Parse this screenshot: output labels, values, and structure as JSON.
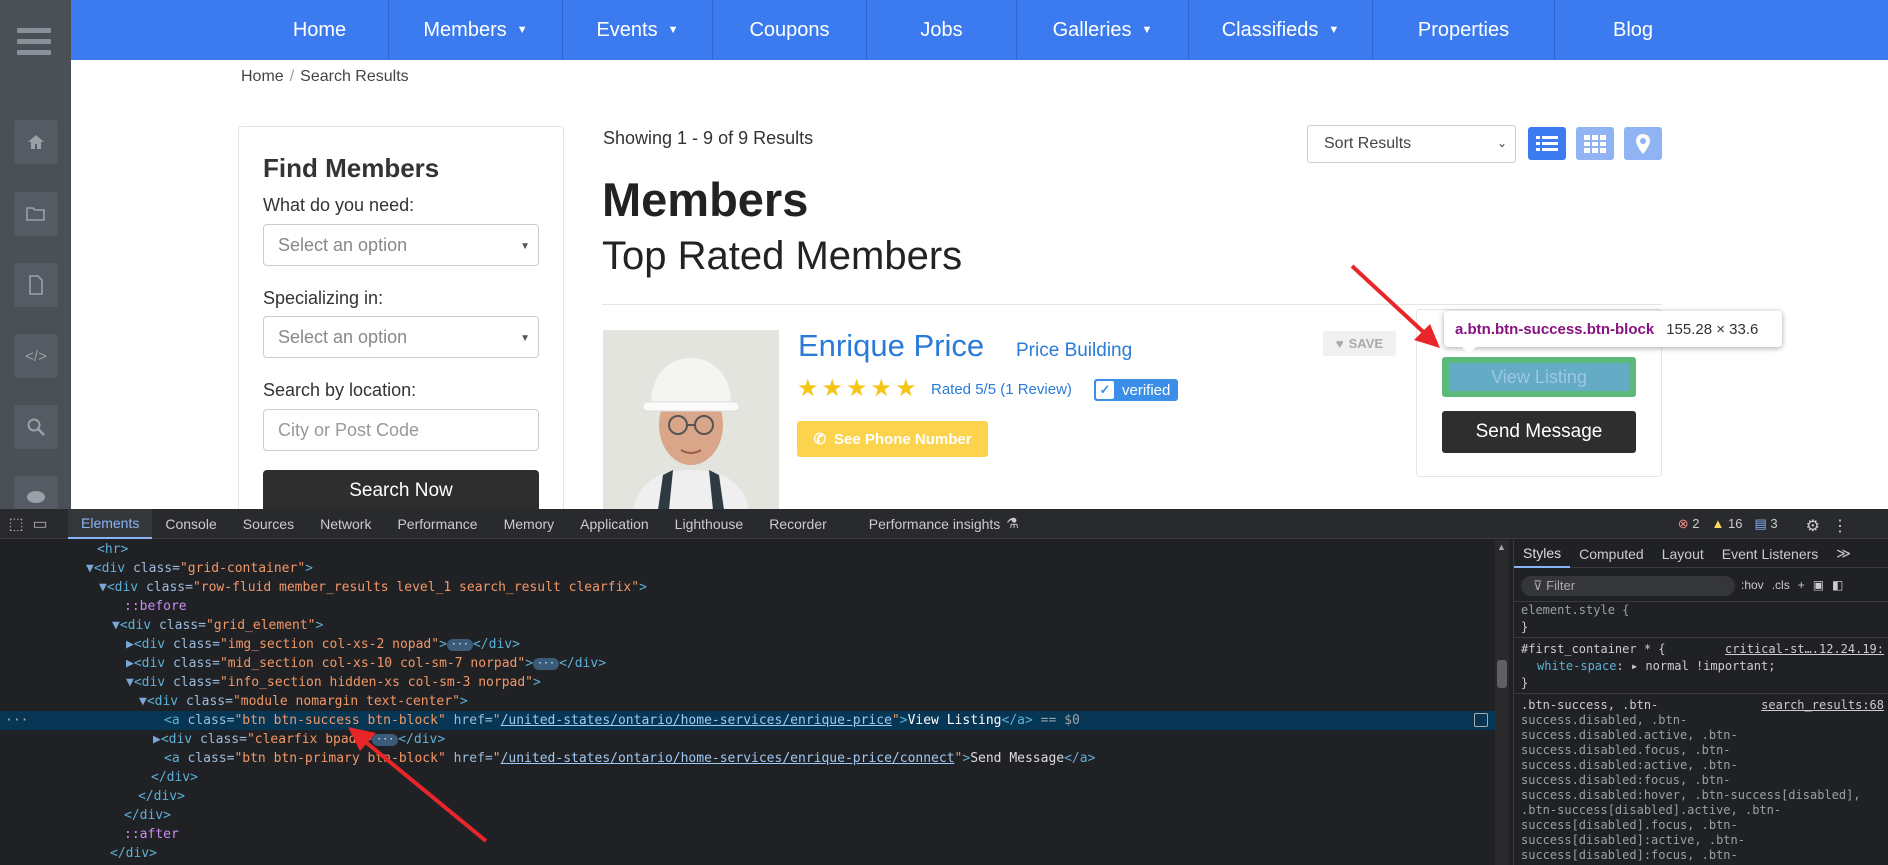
{
  "nav": {
    "items": [
      {
        "label": "Home",
        "dropdown": false
      },
      {
        "label": "Members",
        "dropdown": true
      },
      {
        "label": "Events",
        "dropdown": true
      },
      {
        "label": "Coupons",
        "dropdown": false
      },
      {
        "label": "Jobs",
        "dropdown": false
      },
      {
        "label": "Galleries",
        "dropdown": true
      },
      {
        "label": "Classifieds",
        "dropdown": true
      },
      {
        "label": "Properties",
        "dropdown": false
      },
      {
        "label": "Blog",
        "dropdown": false
      }
    ],
    "color": "#3b7bef"
  },
  "sidebar_icons": [
    "hamburger-icon",
    "home-icon",
    "folder-icon",
    "file-icon",
    "code-icon",
    "zoom-icon",
    "chat-icon"
  ],
  "breadcrumb": {
    "home": "Home",
    "sep": "/",
    "current": "Search Results"
  },
  "find_members": {
    "title": "Find Members",
    "need_label": "What do you need:",
    "need_value": "Select an option",
    "spec_label": "Specializing in:",
    "spec_value": "Select an option",
    "location_label": "Search by location:",
    "location_placeholder": "City or Post Code",
    "search_button": "Search Now"
  },
  "results": {
    "showing": "Showing 1 - 9 of 9 Results",
    "sort_label": "Sort Results",
    "title": "Members",
    "subtitle": "Top Rated Members"
  },
  "member": {
    "name": "Enrique Price",
    "company": "Price Building",
    "stars": "★★★★★",
    "rating_text": "Rated 5/5 (1 Review)",
    "verified": "verified",
    "phone_button": "See Phone Number",
    "save_label": "SAVE",
    "view_listing": "View Listing",
    "send_message": "Send Message"
  },
  "tooltip": {
    "selector": "a.btn.btn-success.btn-block",
    "dims": "155.28 × 33.6"
  },
  "devtools": {
    "tabs": [
      "Elements",
      "Console",
      "Sources",
      "Network",
      "Performance",
      "Memory",
      "Application",
      "Lighthouse",
      "Recorder",
      "Performance insights"
    ],
    "errors": "2",
    "warnings": "16",
    "messages": "3",
    "styles_tabs": [
      "Styles",
      "Computed",
      "Layout",
      "Event Listeners"
    ],
    "filter_placeholder": "Filter",
    "hov": ":hov",
    "cls": ".cls",
    "dom_lines": {
      "l0": "<hr>",
      "l1_tag": "<div ",
      "l1_attr": "class=",
      "l1_val": "\"grid-container\"",
      "l1_end": ">",
      "l2_tag": "<div ",
      "l2_attr": "class=",
      "l2_val": "\"row-fluid member_results level_1 search_result clearfix\"",
      "l2_end": ">",
      "l3": "::before",
      "l4_tag": "<div ",
      "l4_attr": "class=",
      "l4_val": "\"grid_element\"",
      "l4_end": ">",
      "l5_tag": "<div ",
      "l5_attr": "class=",
      "l5_val": "\"img_section col-xs-2 nopad\"",
      "l5_end": "</div>",
      "l6_tag": "<div ",
      "l6_attr": "class=",
      "l6_val": "\"mid_section col-xs-10 col-sm-7 norpad\"",
      "l6_end": "</div>",
      "l7_tag": "<div ",
      "l7_attr": "class=",
      "l7_val": "\"info_section hidden-xs col-sm-3 norpad\"",
      "l7_end": ">",
      "l8_tag": "<div ",
      "l8_attr": "class=",
      "l8_val": "\"module nomargin text-center\"",
      "l8_end": ">",
      "l9_tag": "<a ",
      "l9_attr": "class=",
      "l9_val": "\"btn btn-success btn-block\"",
      "l9_attr2": " href=",
      "l9_href": "/united-states/ontario/home-services/enrique-price",
      "l9_text": "View Listing",
      "l9_close": "</a>",
      "l9_eq": " == $0",
      "l10_tag": "<div ",
      "l10_attr": "class=",
      "l10_val": "\"clearfix bpad\"",
      "l10_end": "</div>",
      "l11_tag": "<a ",
      "l11_attr": "class=",
      "l11_val": "\"btn btn-primary btn-block\"",
      "l11_attr2": " href=",
      "l11_href": "/united-states/ontario/home-services/enrique-price/connect",
      "l11_text": "Send Message",
      "l11_close": "</a>",
      "l12": "</div>",
      "l13": "</div>",
      "l14": "</div>",
      "l15": "::after",
      "l16": "</div>"
    },
    "styles": {
      "element_style": "element.style {",
      "brace_close": "}",
      "rule1_selector": "#first_container * {",
      "rule1_source": "critical-st….12.24.19:",
      "rule1_prop": "white-space",
      "rule1_value": "normal !important;",
      "rule2_source": "search_results:68",
      "rule2_lines": [
        ".btn-success, .btn-",
        "success.disabled, .btn-",
        "success.disabled.active, .btn-",
        "success.disabled.focus, .btn-",
        "success.disabled:active, .btn-",
        "success.disabled:focus, .btn-",
        "success.disabled:hover, .btn-success[disabled],",
        ".btn-success[disabled].active, .btn-",
        "success[disabled].focus, .btn-",
        "success[disabled]:active, .btn-",
        "success[disabled]:focus, .btn-"
      ]
    }
  }
}
